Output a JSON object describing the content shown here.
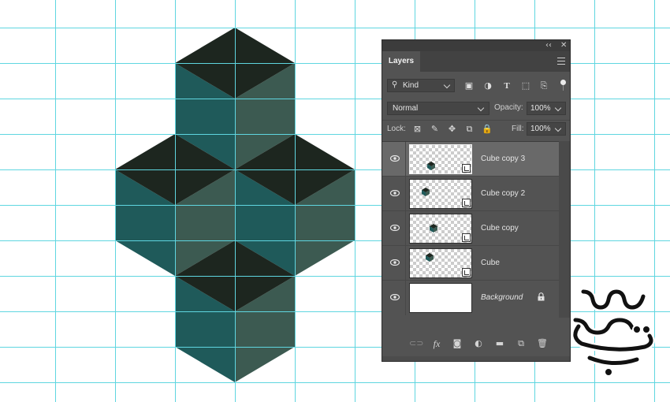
{
  "colors": {
    "guide": "#5fd6e0",
    "cube_top": "#1d261f",
    "cube_left": "#1f5a5a",
    "cube_right": "#3c5a51",
    "panel_bg": "#535353",
    "selected_row": "#696969"
  },
  "panel": {
    "topbar": {
      "collapse_icon": "collapse-double-arrow-icon",
      "close_icon": "close-icon",
      "collapse_glyph": "‹‹",
      "close_glyph": "✕"
    },
    "tab_label": "Layers",
    "menu_icon": "panel-menu-icon",
    "filter": {
      "kind_label": "Kind",
      "search_icon": "search-icon",
      "icons": [
        "pixel-filter-icon",
        "adjustment-filter-icon",
        "type-filter-icon",
        "shape-filter-icon",
        "smart-object-filter-icon"
      ],
      "icon_glyphs": [
        "▣",
        "◑",
        "T",
        "⬚",
        "⎘"
      ]
    },
    "blend": {
      "mode": "Normal",
      "opacity_label": "Opacity:",
      "opacity_value": "100%"
    },
    "lock": {
      "label": "Lock:",
      "icons": [
        "lock-transparent-pixels-icon",
        "lock-image-pixels-icon",
        "lock-position-icon",
        "lock-artboard-icon",
        "lock-all-icon"
      ],
      "icon_glyphs": [
        "⊠",
        "✎",
        "✥",
        "⧉",
        "🔒"
      ],
      "fill_label": "Fill:",
      "fill_value": "100%"
    },
    "layers": [
      {
        "name": "Cube copy 3",
        "selected": true,
        "visible": true,
        "smart_object": true,
        "locked": false
      },
      {
        "name": "Cube copy 2",
        "selected": false,
        "visible": true,
        "smart_object": true,
        "locked": false
      },
      {
        "name": "Cube copy",
        "selected": false,
        "visible": true,
        "smart_object": true,
        "locked": false
      },
      {
        "name": "Cube",
        "selected": false,
        "visible": true,
        "smart_object": true,
        "locked": false
      },
      {
        "name": "Background",
        "selected": false,
        "visible": true,
        "smart_object": false,
        "locked": true
      }
    ],
    "bottom_toolbar": {
      "icons": [
        "link-layers-icon",
        "layer-style-fx-icon",
        "add-mask-icon",
        "adjustment-layer-icon",
        "new-group-folder-icon",
        "new-layer-icon",
        "delete-trash-icon"
      ],
      "glyphs": [
        "⊂⊃",
        "fx",
        "◙",
        "◐",
        "▬",
        "⧉",
        "🗑"
      ]
    }
  },
  "watermark": {
    "icon": "persian-logo-icon"
  }
}
